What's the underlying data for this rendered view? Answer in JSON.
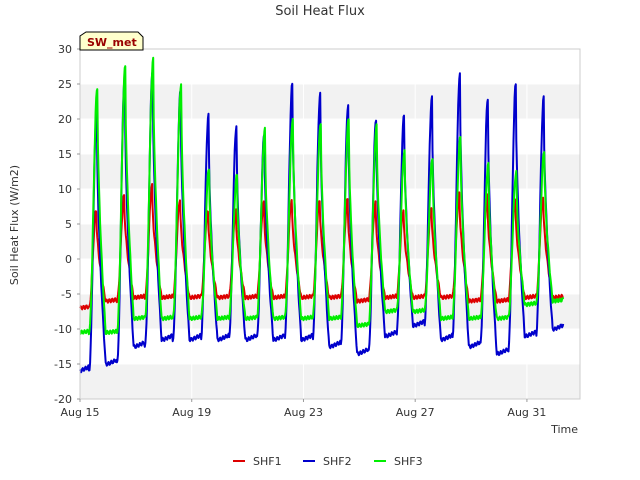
{
  "chart_data": {
    "type": "line",
    "title": "Soil Heat Flux",
    "xlabel": "Time",
    "ylabel": "Soil Heat Flux (W/m2)",
    "badge": "SW_met",
    "xlim": [
      0,
      17.9
    ],
    "ylim": [
      -20,
      30
    ],
    "yticks": [
      -20,
      -15,
      -10,
      -5,
      0,
      5,
      10,
      15,
      20,
      25,
      30
    ],
    "xticks": [
      {
        "label": "Aug 15",
        "value": 0
      },
      {
        "label": "Aug 19",
        "value": 4
      },
      {
        "label": "Aug 23",
        "value": 8
      },
      {
        "label": "Aug 27",
        "value": 12
      },
      {
        "label": "Aug 31",
        "value": 16
      }
    ],
    "x_units": "days since Aug 15",
    "legend_position": "bottom-center",
    "grid": true,
    "colors": {
      "SHF1": "#dd0000",
      "SHF2": "#0000cc",
      "SHF3": "#00ee00",
      "band": "#f2f2f2",
      "grid": "#ffffff",
      "badge_bg": "#ffffcc",
      "badge_text": "#990000"
    },
    "series": [
      {
        "name": "SHF1",
        "daily_min": [
          -7.0,
          -6.0,
          -5.5,
          -5.5,
          -5.5,
          -5.5,
          -5.5,
          -5.5,
          -5.5,
          -5.5,
          -6.0,
          -5.5,
          -5.5,
          -5.5,
          -6.0,
          -6.0,
          -5.5,
          -5.5
        ],
        "daily_max": [
          7.0,
          9.0,
          10.5,
          8.5,
          7.0,
          7.0,
          8.0,
          8.5,
          8.5,
          8.5,
          8.0,
          7.0,
          7.5,
          9.5,
          9.0,
          8.5,
          9.0
        ]
      },
      {
        "name": "SHF2",
        "daily_min": [
          -16.0,
          -15.0,
          -12.5,
          -11.5,
          -11.5,
          -11.5,
          -11.5,
          -11.5,
          -11.5,
          -12.5,
          -13.5,
          -11.0,
          -9.5,
          -11.5,
          -12.5,
          -13.5,
          -11.0,
          -10.0
        ],
        "daily_max": [
          21.5,
          26.0,
          27.0,
          24.0,
          20.5,
          19.0,
          18.0,
          25.0,
          23.5,
          22.0,
          20.0,
          20.5,
          23.0,
          26.5,
          23.0,
          25.0,
          23.0
        ]
      },
      {
        "name": "SHF3",
        "daily_min": [
          -10.5,
          -10.5,
          -8.5,
          -8.5,
          -8.5,
          -8.5,
          -8.5,
          -8.5,
          -8.5,
          -8.5,
          -9.5,
          -7.5,
          -7.5,
          -8.5,
          -8.5,
          -8.5,
          -6.5,
          -6.0
        ],
        "daily_max": [
          24.5,
          27.5,
          28.5,
          25.0,
          13.0,
          12.0,
          18.5,
          20.0,
          19.5,
          20.0,
          19.0,
          15.5,
          14.5,
          17.5,
          13.5,
          12.5,
          15.5
        ]
      }
    ]
  }
}
